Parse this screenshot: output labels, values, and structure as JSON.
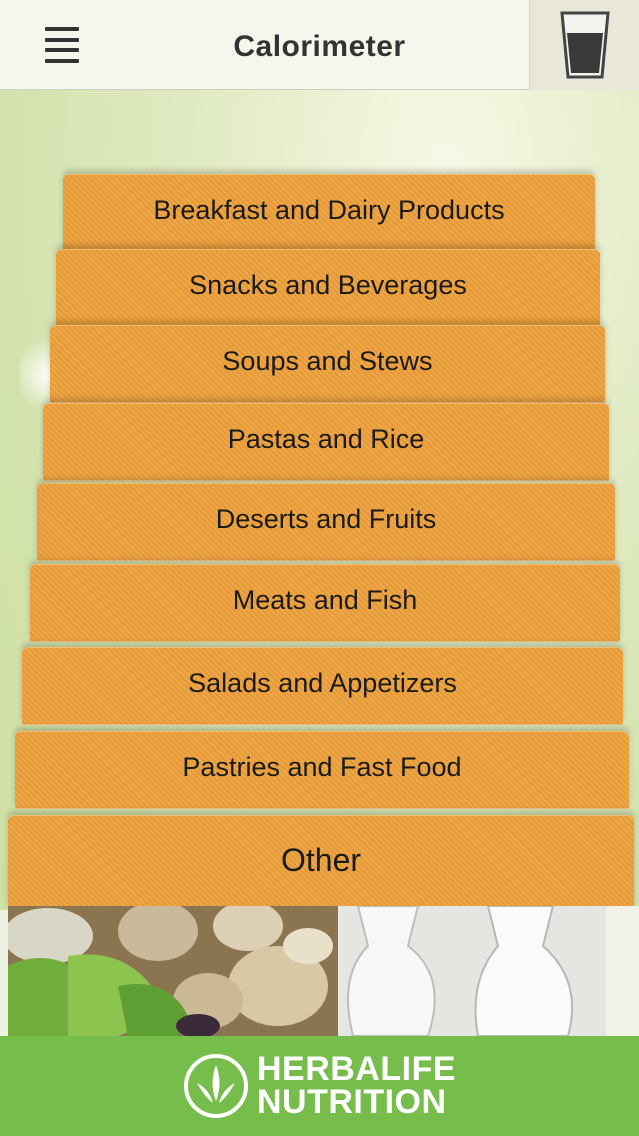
{
  "header": {
    "title": "Calorimeter"
  },
  "categories": [
    "Breakfast and Dairy Products",
    "Snacks and Beverages",
    "Soups and Stews",
    "Pastas and Rice",
    "Deserts and Fruits",
    "Meats and Fish",
    "Salads and Appetizers",
    "Pastries and Fast Food",
    "Other"
  ],
  "footer": {
    "brand_line1": "HERBALIFE",
    "brand_line2": "NUTRITION"
  },
  "icons": {
    "menu": "hamburger-menu-icon",
    "glass": "water-glass-icon",
    "logo": "herbalife-leaf-logo"
  },
  "colors": {
    "category_bg": "#eda03a",
    "footer_bg": "#76bd4b",
    "header_bg": "#f7f6ec"
  }
}
